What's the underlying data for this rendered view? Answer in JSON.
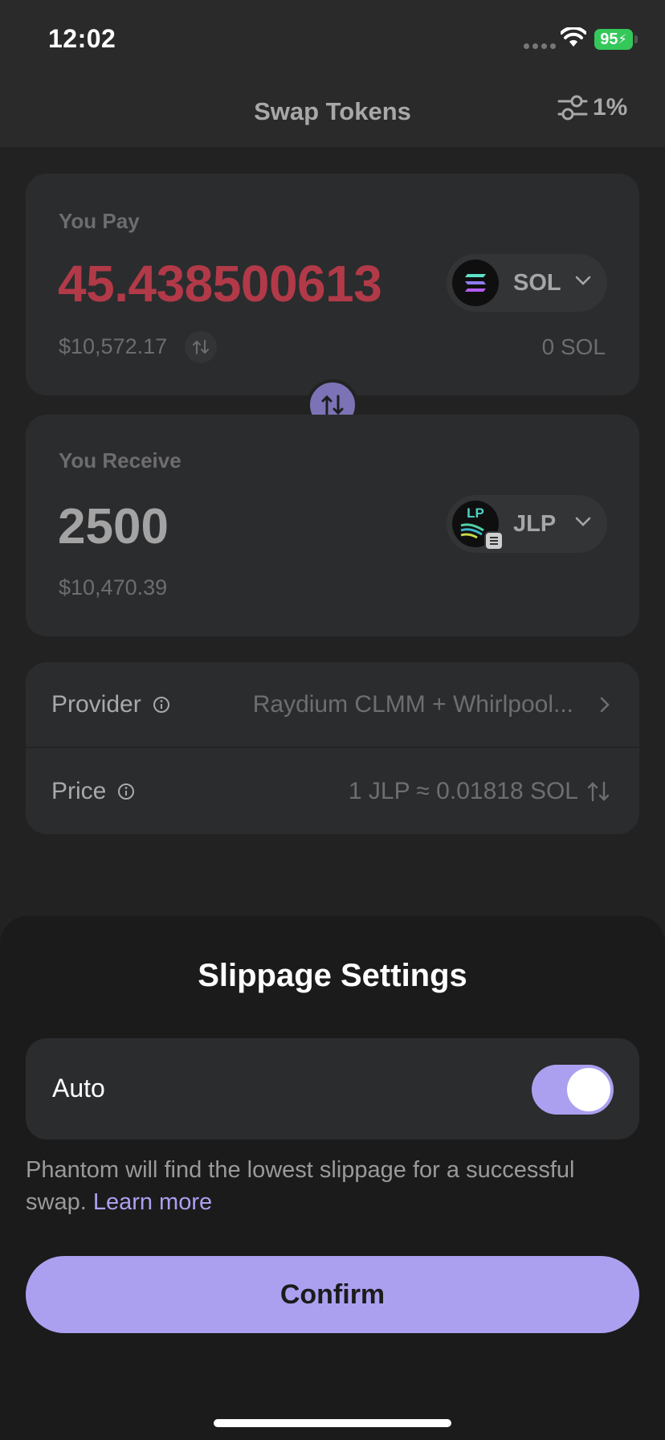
{
  "status_bar": {
    "time": "12:02",
    "battery": "95"
  },
  "header": {
    "title": "Swap Tokens",
    "slippage_value": "1%"
  },
  "pay": {
    "label": "You Pay",
    "amount": "45.438500613",
    "fiat": "$10,572.17",
    "token": "SOL",
    "balance": "0 SOL"
  },
  "receive": {
    "label": "You Receive",
    "amount": "2500",
    "fiat": "$10,470.39",
    "token": "JLP",
    "token_icon_text": "LP"
  },
  "details": {
    "provider_label": "Provider",
    "provider_value": "Raydium CLMM + Whirlpool...",
    "price_label": "Price",
    "price_value": "1 JLP ≈ 0.01818 SOL"
  },
  "sheet": {
    "title": "Slippage Settings",
    "auto_label": "Auto",
    "auto_enabled": true,
    "help_text": "Phantom will find the lowest slippage for a successful swap.",
    "learn_more": "Learn more",
    "confirm_label": "Confirm"
  },
  "colors": {
    "accent": "#aba0f0",
    "pay_amount": "#b23a48",
    "battery": "#34c759"
  }
}
